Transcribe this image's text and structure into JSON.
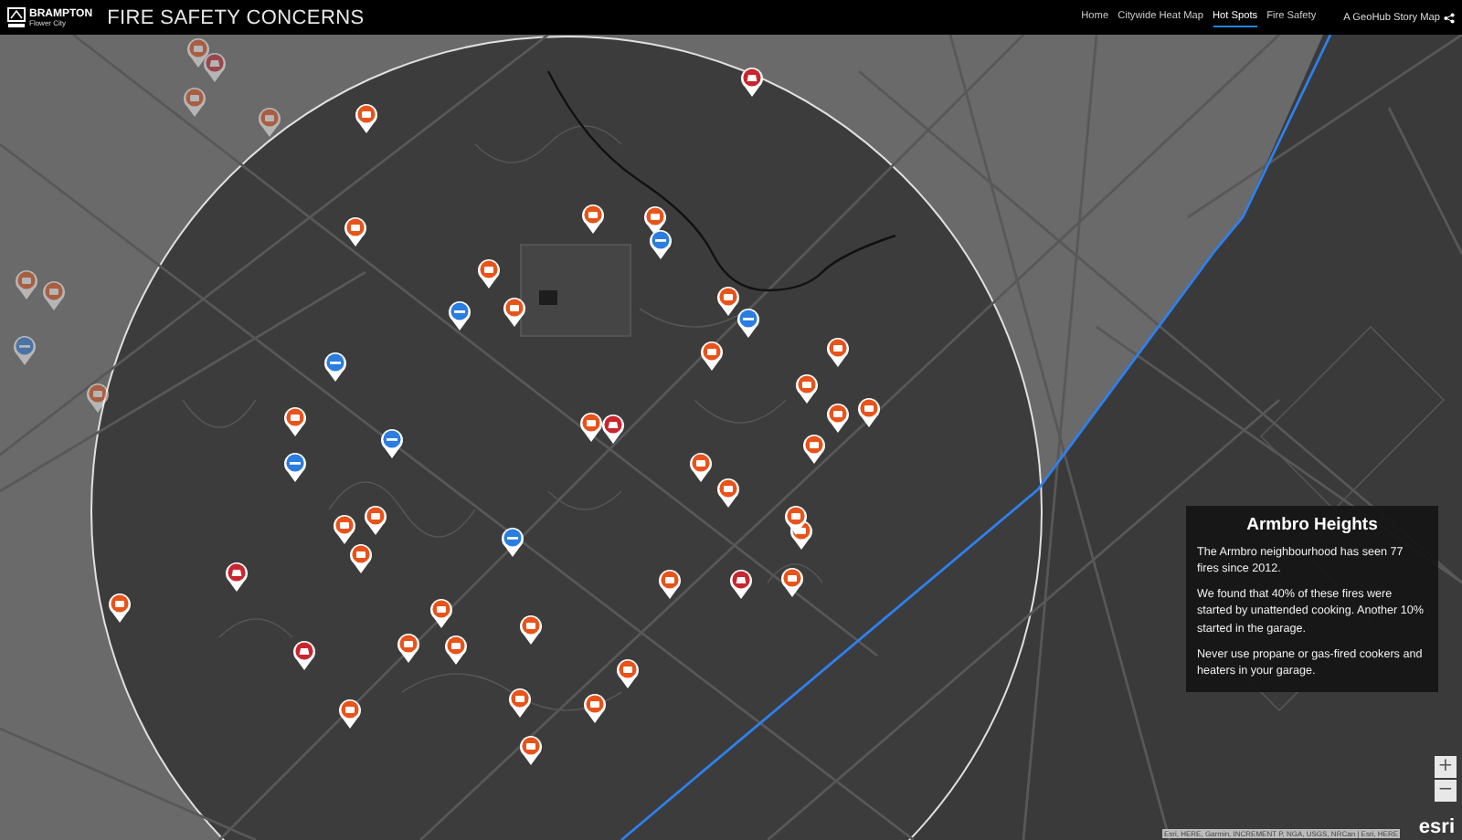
{
  "header": {
    "logo": {
      "name": "BRAMPTON",
      "tagline": "Flower City"
    },
    "title": "FIRE SAFETY CONCERNS",
    "nav": [
      {
        "label": "Home",
        "selected": false
      },
      {
        "label": "Citywide Heat Map",
        "selected": false
      },
      {
        "label": "Hot Spots",
        "selected": true
      },
      {
        "label": "Fire Safety",
        "selected": false
      }
    ],
    "story_link": "A GeoHub Story Map"
  },
  "map": {
    "markers": [
      {
        "kind": "cooking"
      },
      {
        "kind": "vehicle"
      },
      {
        "kind": "cooking"
      },
      {
        "kind": "cooking"
      },
      {
        "kind": "cooking"
      },
      {
        "kind": "cooking"
      },
      {
        "kind": "smoking"
      },
      {
        "kind": "cooking"
      },
      {
        "kind": "cooking"
      },
      {
        "kind": "vehicle"
      },
      {
        "kind": "cooking"
      },
      {
        "kind": "cooking"
      },
      {
        "kind": "cooking"
      },
      {
        "kind": "smoking"
      },
      {
        "kind": "cooking"
      },
      {
        "kind": "smoking"
      },
      {
        "kind": "cooking"
      },
      {
        "kind": "cooking"
      },
      {
        "kind": "smoking"
      },
      {
        "kind": "cooking"
      },
      {
        "kind": "cooking"
      },
      {
        "kind": "cooking"
      },
      {
        "kind": "smoking"
      },
      {
        "kind": "cooking"
      },
      {
        "kind": "smoking"
      },
      {
        "kind": "smoking"
      },
      {
        "kind": "cooking"
      },
      {
        "kind": "vehicle"
      },
      {
        "kind": "cooking"
      },
      {
        "kind": "cooking"
      },
      {
        "kind": "cooking"
      },
      {
        "kind": "cooking"
      },
      {
        "kind": "cooking"
      },
      {
        "kind": "cooking"
      },
      {
        "kind": "cooking"
      },
      {
        "kind": "cooking"
      },
      {
        "kind": "cooking"
      },
      {
        "kind": "cooking"
      },
      {
        "kind": "smoking"
      },
      {
        "kind": "vehicle"
      },
      {
        "kind": "cooking"
      },
      {
        "kind": "cooking"
      },
      {
        "kind": "vehicle"
      },
      {
        "kind": "cooking"
      },
      {
        "kind": "cooking"
      },
      {
        "kind": "cooking"
      },
      {
        "kind": "cooking"
      },
      {
        "kind": "cooking"
      },
      {
        "kind": "vehicle"
      },
      {
        "kind": "cooking"
      },
      {
        "kind": "cooking"
      },
      {
        "kind": "cooking"
      },
      {
        "kind": "cooking"
      },
      {
        "kind": "cooking"
      }
    ],
    "zoom_in": "+",
    "zoom_out": "−",
    "attribution": "Esri, HERE, Garmin, INCREMENT P, NGA, USGS, NRCan | Esri, HERE",
    "esri_logo": "esri"
  },
  "info_panel": {
    "title": "Armbro Heights",
    "paragraphs": [
      "The Armbro neighbourhood has seen 77 fires since 2012.",
      "We found that 40% of these fires were started by unattended cooking. Another 10% started in the garage.",
      "Never use propane or gas-fired cookers and heaters in your garage."
    ]
  }
}
